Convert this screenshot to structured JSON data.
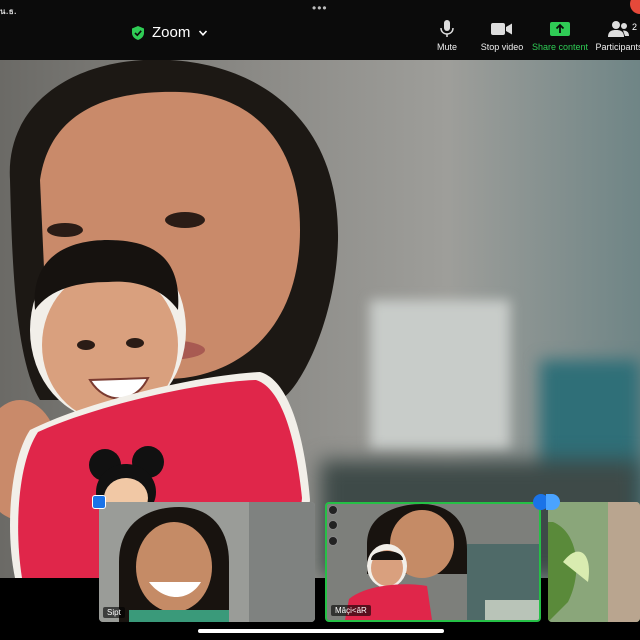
{
  "status_bar": {
    "time": "น.ธ."
  },
  "meeting": {
    "title": "Zoom"
  },
  "toolbar": {
    "mute_label": "Mute",
    "stop_video_label": "Stop video",
    "share_label": "Share content",
    "participants_label": "Participants",
    "participants_count": "2"
  },
  "thumbnails": [
    {
      "name": "Sipt"
    },
    {
      "name": "Mâçi<âR"
    },
    {
      "name": ""
    }
  ],
  "colors": {
    "accent_green": "#25c046",
    "blue": "#1a73e8",
    "record_red": "#e5493a"
  }
}
